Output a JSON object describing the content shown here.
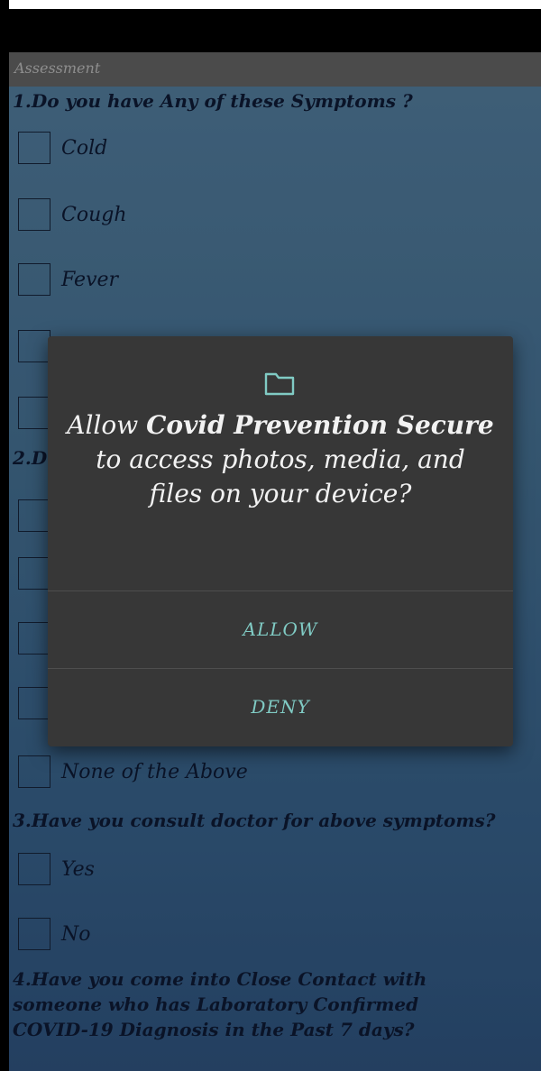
{
  "appbar": {
    "title": "Assessment"
  },
  "questions": [
    {
      "text": "1.Do you have Any of these Symptoms ?",
      "options": [
        "Cold",
        "Cough",
        "Fever"
      ]
    },
    {
      "text": "3.Have you consult doctor for above symptoms?",
      "options": [
        "Yes",
        "No"
      ]
    },
    {
      "text": "4.Have you come into Close Contact with someone who has Laboratory Confirmed COVID-19 Diagnosis in the Past 7 days?"
    }
  ],
  "partial": {
    "q2_prefix": "2.D",
    "none_option": "None of the Above"
  },
  "dialog": {
    "icon": "folder-icon",
    "msg_before": "Allow ",
    "app_name": "Covid Prevention Secure",
    "msg_after": " to access photos, media, and files on your device?",
    "allow_label": "ALLOW",
    "deny_label": "DENY"
  },
  "colors": {
    "accent": "#80cbc4",
    "dialog_bg": "#373737",
    "appbar_bg": "#4b4b4b"
  }
}
